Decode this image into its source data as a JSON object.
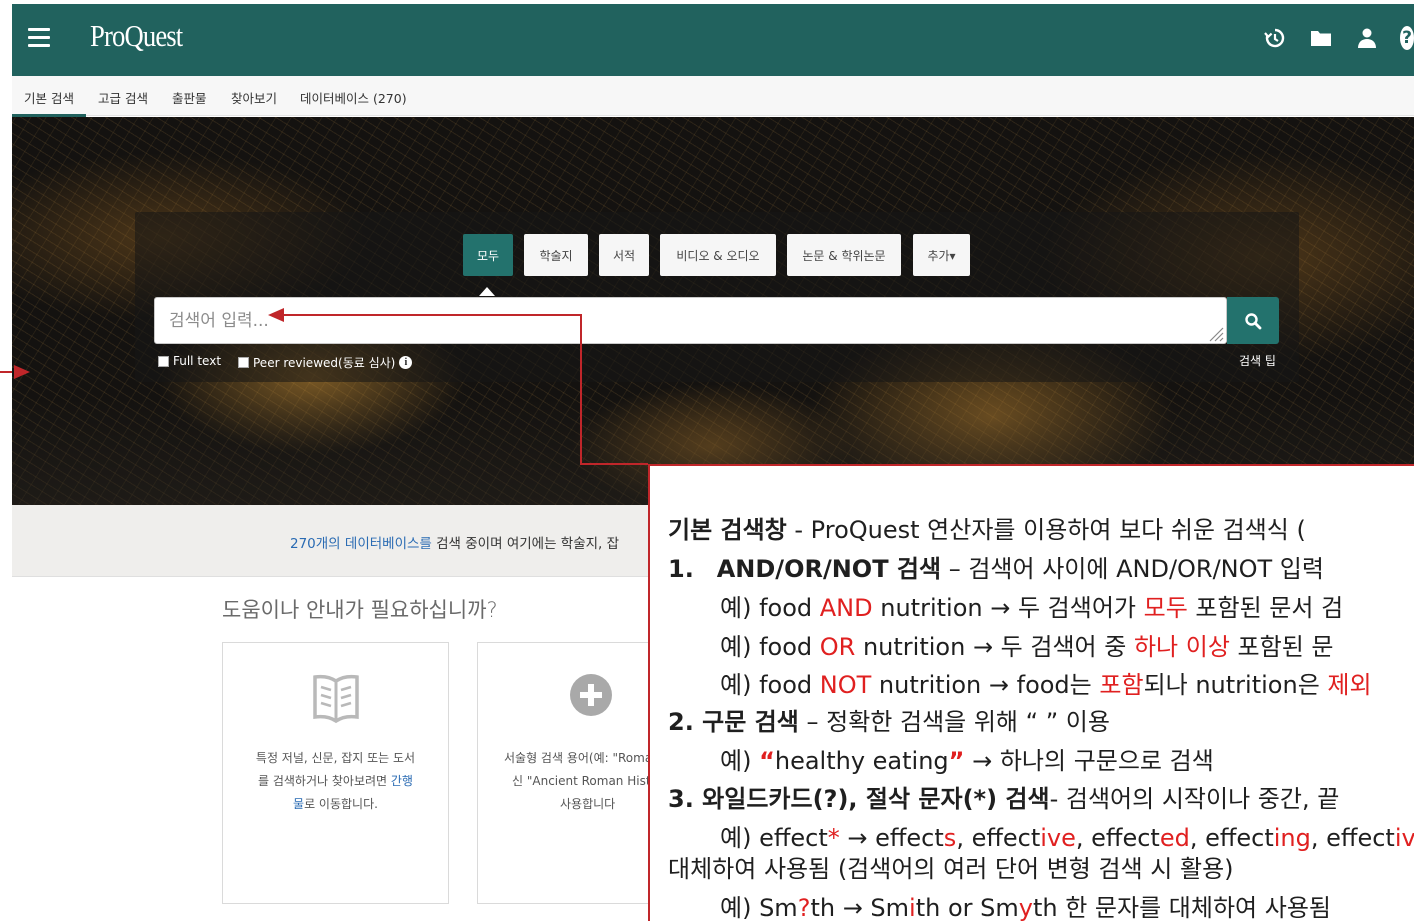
{
  "header": {
    "menu_icon": "hamburger-icon",
    "logo": "ProQuest",
    "icons": [
      "history-icon",
      "folder-icon",
      "user-icon",
      "help-icon"
    ],
    "help_glyph": "?"
  },
  "nav": {
    "tabs": [
      {
        "label": "기본 검색",
        "active": true
      },
      {
        "label": "고급 검색"
      },
      {
        "label": "출판물"
      },
      {
        "label": "찾아보기"
      },
      {
        "label": "데이터베이스 (270)"
      }
    ]
  },
  "search": {
    "source_tabs": [
      "모두",
      "학술지",
      "서적",
      "비디오 & 오디오",
      "논문 & 학위논문",
      "추가▾"
    ],
    "placeholder": "검색어 입력...",
    "full_text_label": "Full text",
    "peer_reviewed_label": "Peer reviewed(동료 심사)",
    "info_glyph": "i",
    "tips_label": "검색 팁"
  },
  "databases": {
    "link": "270개의 데이터베이스를",
    "text": " 검색 중이며 여기에는 학술지, 잡"
  },
  "help": {
    "title": "도움이나 안내가 필요하십니까?",
    "card1": {
      "icon": "book-icon",
      "line1": "특정 저널, 신문, 잡지 또는 도서",
      "line2_pre": "를 검색하거나 찾아보려면 ",
      "line2_link": "간행",
      "line3_link": "물",
      "line3_post": "로 이동합니다."
    },
    "card2": {
      "icon": "plus-circle-icon",
      "line1": "서술형 검색 용어(예: \"Roman",
      "line2": "신 \"Ancient Roman History",
      "line3": "사용합니다"
    }
  },
  "annotation": {
    "title_bold": "기본 검색창",
    "title_rest": " - ProQuest 연산자를 이용하여 보다 쉬운 검색식 (",
    "item1_num": "1.",
    "item1_bold": "AND/OR/NOT 검색",
    "item1_rest": " – 검색어 사이에 AND/OR/NOT 입력",
    "ex_and": {
      "pre": "예) food ",
      "op": "AND",
      "mid": " nutrition → 두 검색어가 ",
      "hl": "모두",
      "post": " 포함된 문서 검"
    },
    "ex_or": {
      "pre": "예) food ",
      "op": "OR",
      "mid": " nutrition → 두 검색어 중 ",
      "hl": "하나 이상",
      "post": " 포함된 문"
    },
    "ex_not": {
      "pre": "예) food ",
      "op": "NOT",
      "mid": " nutrition → food는 ",
      "hl": "포함",
      "mid2": "되나 nutrition은 ",
      "hl2": "제외"
    },
    "item2_bold": "2. 구문 검색",
    "item2_rest": " – 정확한 검색을 위해 “  ” 이용",
    "ex_phrase": {
      "pre": "예) ",
      "q1": "“",
      "phrase": "healthy eating",
      "q2": "”",
      "post": " → 하나의 구문으로 검색"
    },
    "item3_bold": "3. 와일드카드(?), 절삭 문자(*) 검색",
    "item3_rest": "- 검색어의 시작이나 중간, 끝",
    "ex_trunc": {
      "pre": "예) effect",
      "star": "*",
      "arrow": " → effect",
      "s": "s",
      "c1": ", effect",
      "ive": "ive",
      "c2": ", effect",
      "ed": "ed",
      "c3": ", effect",
      "ing": "ing",
      "c4": ", effect",
      "tail": "ive"
    },
    "trunc_note": "대체하여 사용됨 (검색어의 여러 단어 변형 검색 시 활용)",
    "ex_wild": {
      "pre": "예) Sm",
      "q": "?",
      "mid": "th → Sm",
      "i": "i",
      "mid2": "th or Sm",
      "y": "y",
      "post": "th 한 문자를 대체하여 사용됨"
    }
  },
  "colors": {
    "brand": "#21625e",
    "accent": "#23726d",
    "annotation_red": "#c0262a",
    "highlight_red": "#e02020",
    "link": "#2a6bb3"
  }
}
